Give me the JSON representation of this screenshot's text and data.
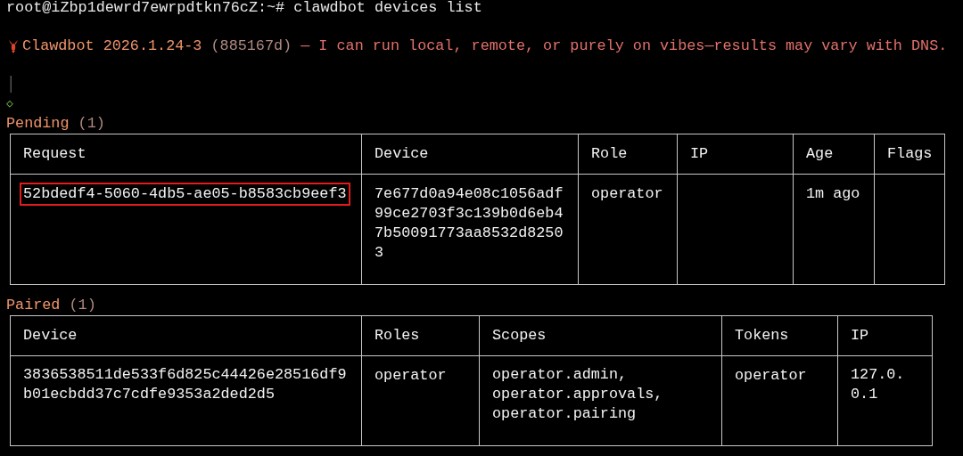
{
  "prompt": {
    "user_host": "root@iZbp1dewrd7ewrpdtkn76cZ:~#",
    "command": "clawdbot devices list"
  },
  "banner": {
    "name": "Clawdbot 2026.1.24-3",
    "commit": "(885167d)",
    "tagline": "— I can run local, remote, or purely on vibes—results may vary with DNS."
  },
  "gutter": "│",
  "marker": "◇",
  "sections": [
    {
      "title": "Pending",
      "count": "(1)",
      "columns": [
        "Request",
        "Device",
        "Role",
        "IP",
        "Age",
        "Flags"
      ],
      "rows": [
        {
          "cells": [
            {
              "text": "52bdedf4-5060-4db5-ae05-b8583cb9eef3",
              "highlighted": true
            },
            {
              "text": "7e677d0a94e08c1056adf99ce2703f3c139b0d6eb47b50091773aa8532d82503"
            },
            {
              "text": "operator"
            },
            {},
            {
              "text": "1m ago"
            },
            {}
          ]
        }
      ]
    },
    {
      "title": "Paired",
      "count": "(1)",
      "columns": [
        "Device",
        "Roles",
        "Scopes",
        "Tokens",
        "IP"
      ],
      "rows": [
        {
          "cells": [
            {
              "text": "3836538511de533f6d825c44426e28516df9b01ecbdd37c7cdfe9353a2ded2d5"
            },
            {
              "text": "operator"
            },
            {
              "text": "operator.admin, operator.approvals, operator.pairing"
            },
            {
              "text": "operator"
            },
            {
              "text": "127.0.0.1"
            }
          ]
        }
      ]
    }
  ]
}
